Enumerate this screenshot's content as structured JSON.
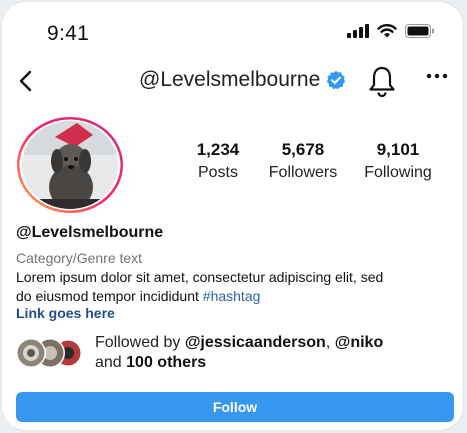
{
  "status_bar": {
    "time": "9:41"
  },
  "header": {
    "handle": "@Levelsmelbourne",
    "back_icon": "chevron-left-icon",
    "verified_icon": "verified-badge-icon",
    "bell_icon": "bell-icon",
    "more_icon": "more-horizontal-icon"
  },
  "stats": [
    {
      "value": "1,234",
      "label": "Posts"
    },
    {
      "value": "5,678",
      "label": "Followers"
    },
    {
      "value": "9,101",
      "label": "Following"
    }
  ],
  "profile": {
    "name": "@Levelsmelbourne",
    "category": "Category/Genre text",
    "bio_line1": "Lorem ipsum dolor sit amet, consectetur adipiscing elit, sed",
    "bio_line2": "do eiusmod tempor incididunt",
    "hashtag": "#hashtag",
    "link": "Link goes here"
  },
  "followed_by": {
    "prefix": "Followed by",
    "user1": "@jessicaanderson",
    "separator": ",",
    "user2": "@niko",
    "and": "and",
    "others": "100 others"
  },
  "actions": {
    "follow_label": "Follow"
  },
  "colors": {
    "accent": "#3897f0",
    "verified": "#3897f0",
    "link": "#1f4e8a",
    "hashtag": "#2a63a8"
  }
}
